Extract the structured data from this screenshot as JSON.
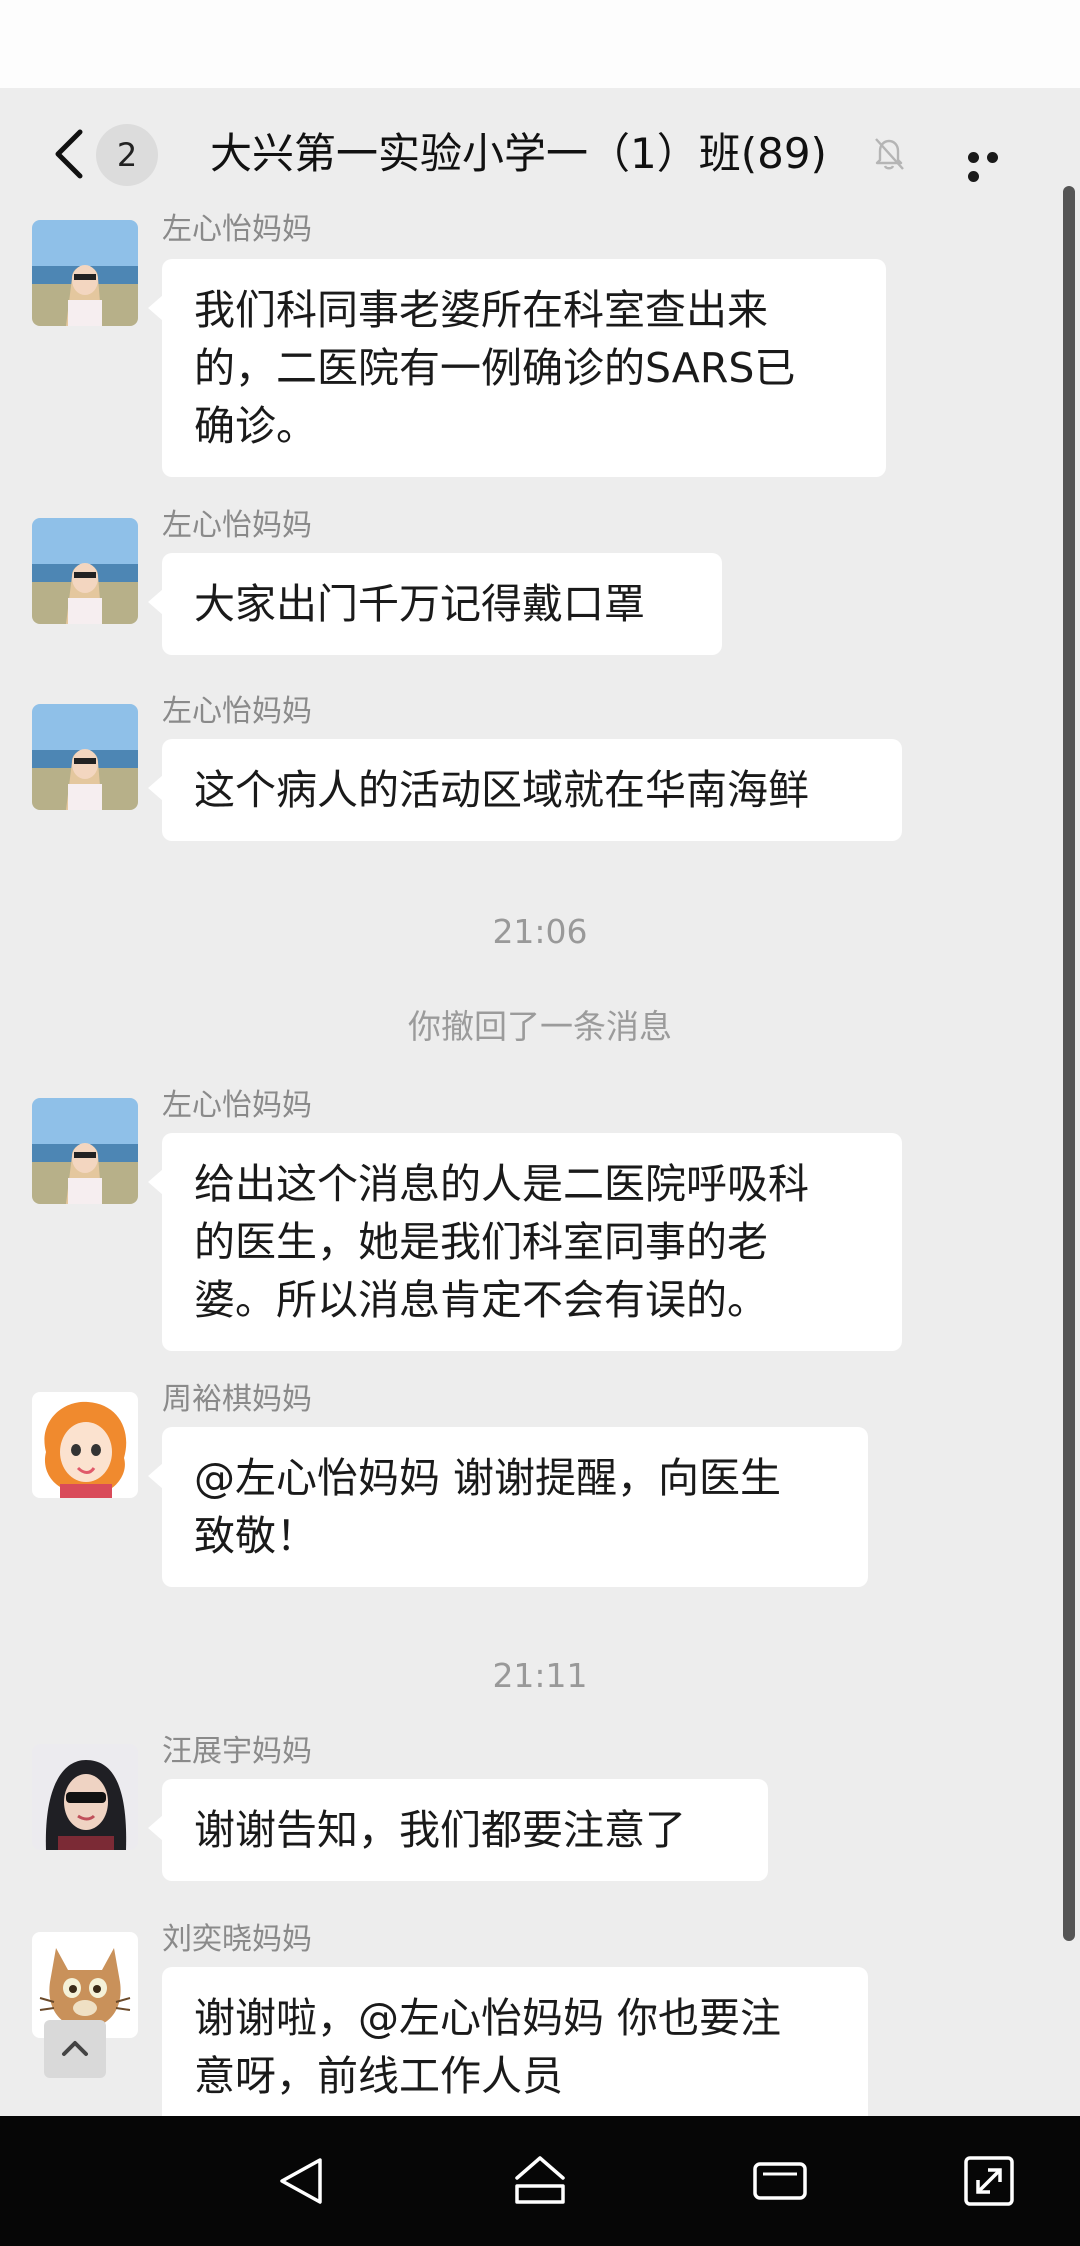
{
  "header": {
    "back_count": "2",
    "title": "大兴第一实验小学一（1）班(89)"
  },
  "messages": [
    {
      "sender": "左心怡妈妈",
      "lines": [
        "我们科同事老婆所在科室查出来",
        "的，二医院有一例确诊的SARS已",
        "确诊。"
      ]
    },
    {
      "sender": "左心怡妈妈",
      "lines": [
        "大家出门千万记得戴口罩"
      ]
    },
    {
      "sender": "左心怡妈妈",
      "lines": [
        "这个病人的活动区域就在华南海鲜"
      ]
    },
    {
      "sender": "左心怡妈妈",
      "lines": [
        "给出这个消息的人是二医院呼吸科",
        "的医生，她是我们科室同事的老",
        "婆。所以消息肯定不会有误的。"
      ]
    },
    {
      "sender": "周裕棋妈妈",
      "lines": [
        "@左心怡妈妈 谢谢提醒，向医生",
        "致敬！"
      ]
    },
    {
      "sender": "汪展宇妈妈",
      "lines": [
        "谢谢告知，我们都要注意了"
      ]
    },
    {
      "sender": "刘奕晓妈妈",
      "lines": [
        "谢谢啦，@左心怡妈妈 你也要注",
        "意呀，前线工作人员"
      ]
    }
  ],
  "timestamps": [
    "21:06",
    "21:11"
  ],
  "system_message": "你撤回了一条消息",
  "icons": {
    "back": "chevron-left-icon",
    "mute": "bell-off-icon",
    "more": "more-dots-icon",
    "scroll_up": "chevron-up-icon",
    "nav": [
      "back-triangle-icon",
      "home-icon",
      "recents-icon",
      "screenshot-icon"
    ]
  },
  "colors": {
    "chat_background": "#ededed",
    "bubble": "#ffffff",
    "nav_bar": "#060606"
  }
}
